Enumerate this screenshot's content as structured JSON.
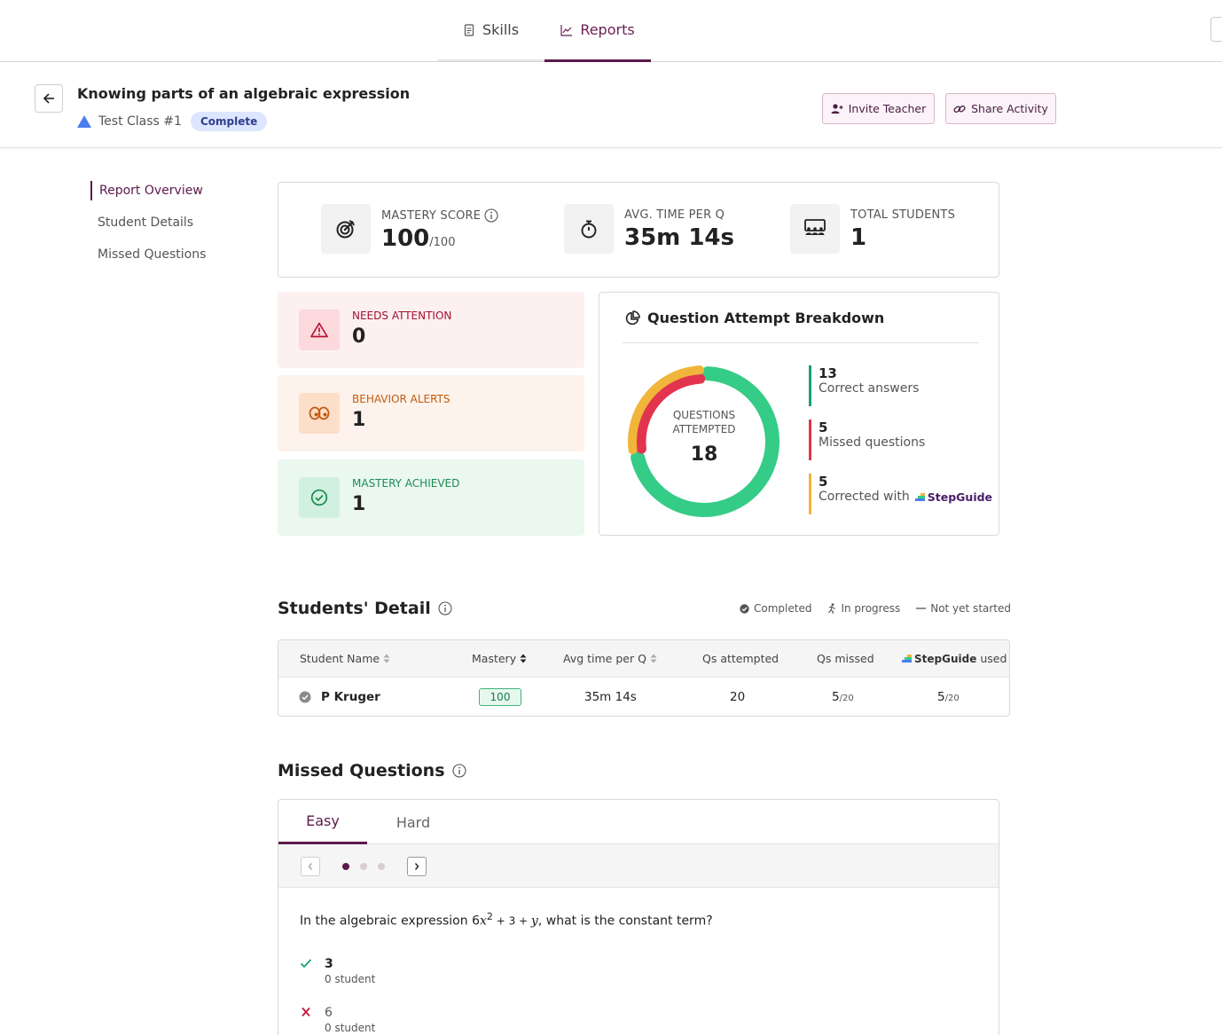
{
  "nav": {
    "tabs": [
      {
        "label": "Skills"
      },
      {
        "label": "Reports"
      }
    ]
  },
  "header": {
    "title": "Knowing parts of an algebraic expression",
    "class_name": "Test Class #1",
    "status": "Complete",
    "invite_label": "Invite Teacher",
    "share_label": "Share Activity"
  },
  "sidebar": {
    "items": [
      {
        "label": "Report Overview"
      },
      {
        "label": "Student Details"
      },
      {
        "label": "Missed Questions"
      }
    ]
  },
  "stats": {
    "mastery": {
      "label": "MASTERY SCORE",
      "value": "100",
      "suffix": "/100"
    },
    "avg_time": {
      "label": "AVG. TIME PER Q",
      "value": "35m 14s"
    },
    "total_students": {
      "label": "TOTAL STUDENTS",
      "value": "1"
    }
  },
  "alerts": {
    "needs_attention": {
      "label": "NEEDS ATTENTION",
      "value": "0"
    },
    "behavior": {
      "label": "BEHAVIOR ALERTS",
      "value": "1"
    },
    "mastery": {
      "label": "MASTERY ACHIEVED",
      "value": "1"
    }
  },
  "breakdown": {
    "title": "Question Attempt Breakdown",
    "center_label_1": "QUESTIONS",
    "center_label_2": "ATTEMPTED",
    "center_value": "18",
    "correct": {
      "value": 13,
      "label": "Correct answers",
      "color": "#34cc87"
    },
    "missed": {
      "value": 5,
      "label": "Missed questions",
      "color": "#e2344f"
    },
    "corrected": {
      "value": 5,
      "label": "Corrected with",
      "color": "#f0b53a"
    },
    "logo_text": "StepGuide"
  },
  "students": {
    "title": "Students' Detail",
    "legend": {
      "completed": "Completed",
      "in_progress": "In progress",
      "not_started": "Not yet started"
    },
    "columns": {
      "name": "Student Name",
      "mastery": "Mastery",
      "avg_time": "Avg time per Q",
      "attempted": "Qs attempted",
      "missed": "Qs missed",
      "stepguide_logo": "StepGuide",
      "stepguide_used": "used"
    },
    "rows": [
      {
        "name": "P Kruger",
        "mastery": "100",
        "avg_time": "35m 14s",
        "attempted": "20",
        "missed": "5",
        "missed_total": "/20",
        "stepguide": "5",
        "stepguide_total": "/20"
      }
    ]
  },
  "missed": {
    "title": "Missed Questions",
    "tabs": [
      {
        "label": "Easy"
      },
      {
        "label": "Hard"
      }
    ],
    "question": {
      "prefix": "In the algebraic expression ",
      "coef": "6",
      "var": "x",
      "exp": "2",
      "mid": " + 3 + ",
      "var2": "y",
      "suffix": ",  what is the constant term?"
    },
    "answers": [
      {
        "value": "3",
        "students": "0 student",
        "correct": true
      },
      {
        "value": "6",
        "students": "0 student",
        "correct": false
      }
    ]
  }
}
